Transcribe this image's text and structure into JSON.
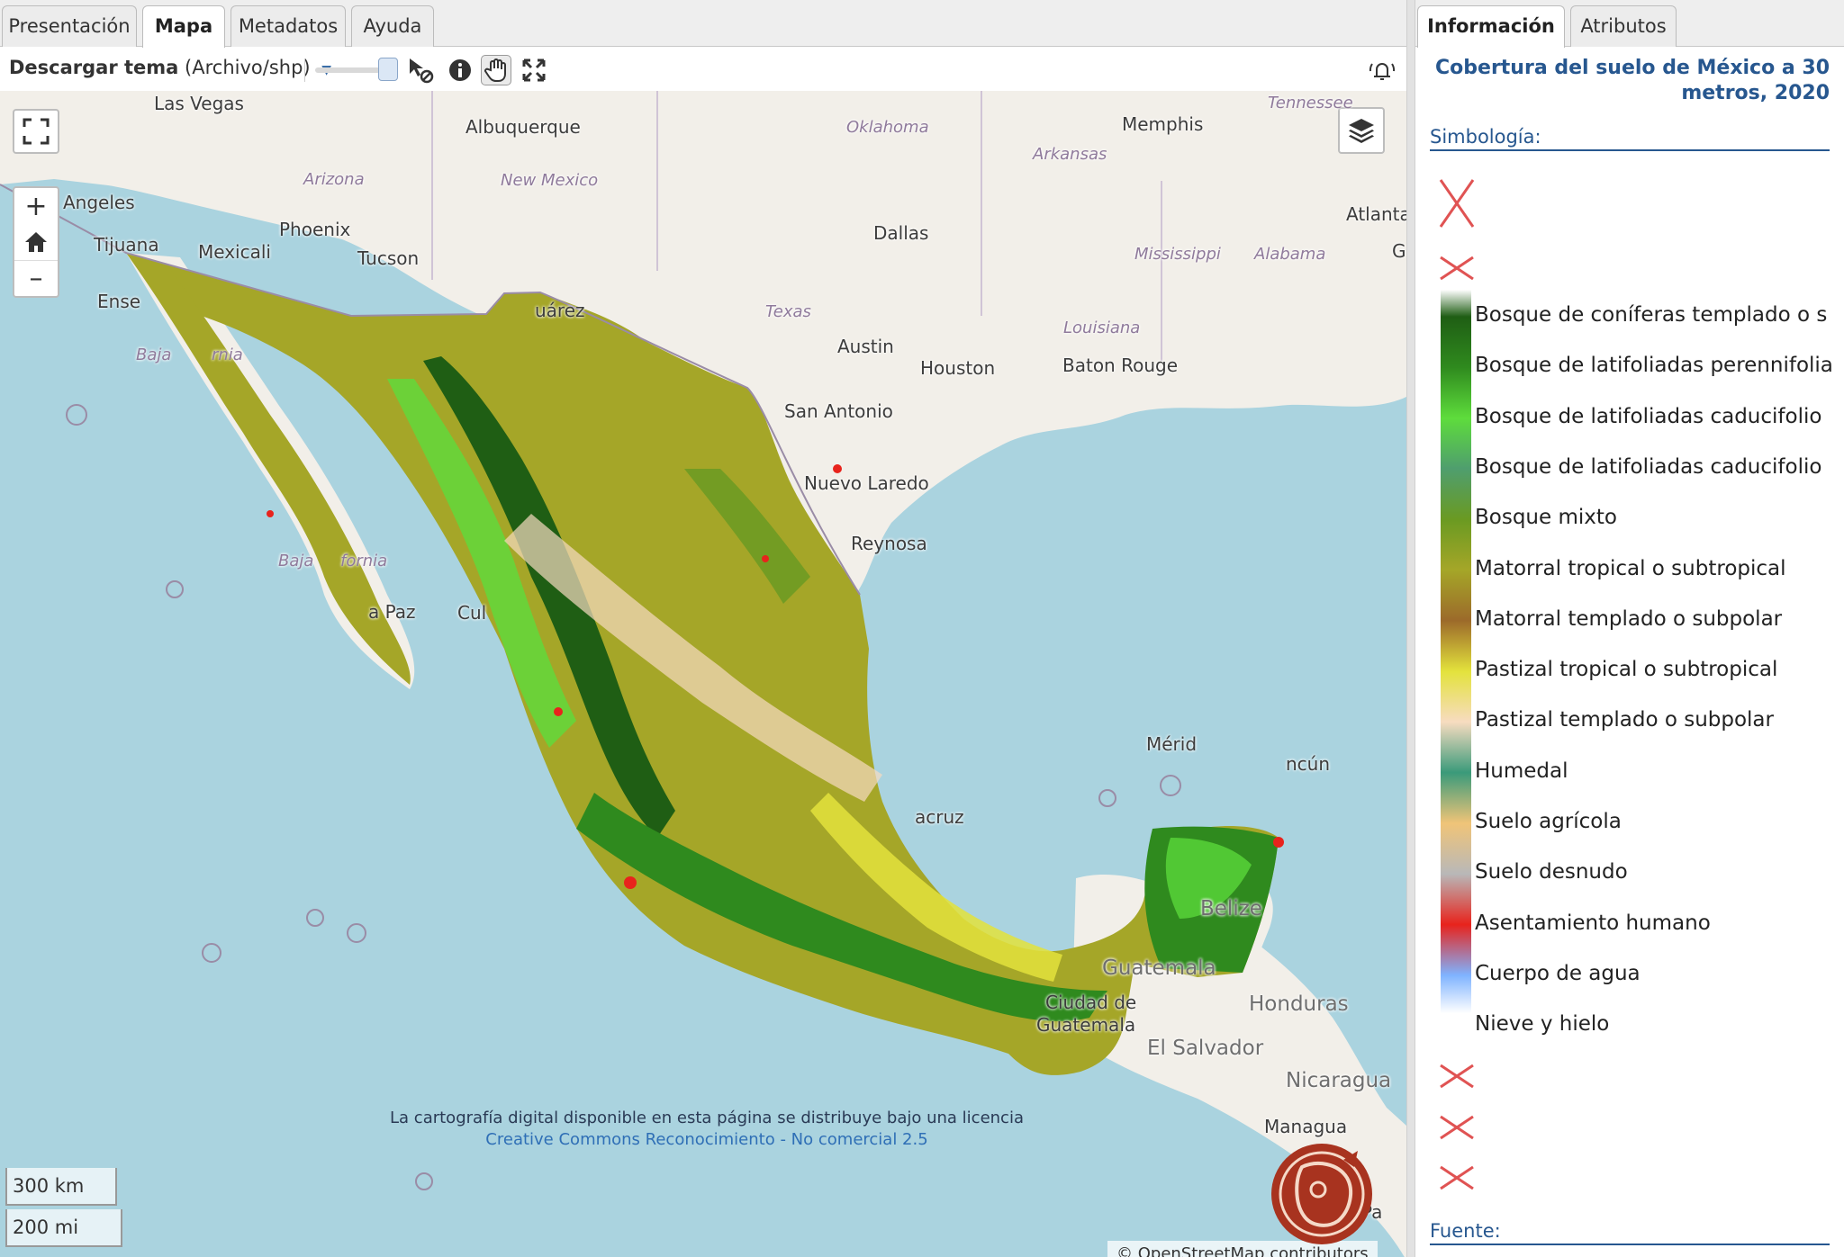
{
  "left_tabs": [
    "Presentación",
    "Mapa",
    "Metadatos",
    "Ayuda"
  ],
  "toolbar": {
    "download_label": "Descargar tema",
    "download_format": "(Archivo/shp)"
  },
  "map": {
    "places": [
      "Las Vegas",
      "Albuquerque",
      "Oklahoma",
      "Arkansas",
      "Memphis",
      "Tennessee",
      "Arizona",
      "New Mexico",
      "Angeles",
      "Phoenix",
      "Tijuana",
      "Mexicali",
      "Tucson",
      "Dallas",
      "Atlanta",
      "Mississippi",
      "Alabama",
      "Ense",
      "uárez",
      "Texas",
      "Louisiana",
      "Austin",
      "Houston",
      "Baton Rouge",
      "Baja",
      "rnia",
      "San Antonio",
      "Nuevo Laredo",
      "Reynosa",
      "Baja",
      "fornia",
      "a Paz",
      "Cul",
      "Mérid",
      "ncún",
      "acruz",
      "Belize",
      "Guatemala",
      "Ciudad de",
      "Guatemala",
      "Honduras",
      "El Salvador",
      "Nicaragua",
      "Managua",
      "Pa",
      "G"
    ],
    "scale_km": "300 km",
    "scale_mi": "200 mi",
    "license_text": "La cartografía digital disponible en esta página se distribuye bajo una licencia",
    "license_link": "Creative Commons Reconocimiento - No comercial 2.5",
    "attribution": "© OpenStreetMap contributors"
  },
  "right_tabs": [
    "Información",
    "Atributos"
  ],
  "panel": {
    "title": "Cobertura del suelo de México a 30 metros, 2020",
    "symbology_label": "Simbología:",
    "source_label": "Fuente:",
    "legend": [
      {
        "label": "Bosque de coníferas templado o s",
        "color": "#1f5e14"
      },
      {
        "label": "Bosque de latifoliadas perennifolia",
        "color": "#2f8a1e"
      },
      {
        "label": "Bosque de latifoliadas caducifolio",
        "color": "#5edc3c"
      },
      {
        "label": "Bosque de latifoliadas caducifolio",
        "color": "#4f9e6e"
      },
      {
        "label": "Bosque mixto",
        "color": "#6a9a22"
      },
      {
        "label": "Matorral tropical o subtropical",
        "color": "#a5a628"
      },
      {
        "label": "Matorral templado o subpolar",
        "color": "#9c6a2a"
      },
      {
        "label": "Pastizal tropical o subtropical",
        "color": "#e3e23c"
      },
      {
        "label": "Pastizal templado o subpolar",
        "color": "#f7dcc0"
      },
      {
        "label": "Humedal",
        "color": "#3a9a7a"
      },
      {
        "label": "Suelo agrícola",
        "color": "#f0c478"
      },
      {
        "label": "Suelo desnudo",
        "color": "#b8b8b8"
      },
      {
        "label": "Asentamiento humano",
        "color": "#e8231c"
      },
      {
        "label": "Cuerpo de agua",
        "color": "#7fb3ff"
      },
      {
        "label": "Nieve y hielo",
        "color": "#ffffff"
      }
    ]
  }
}
